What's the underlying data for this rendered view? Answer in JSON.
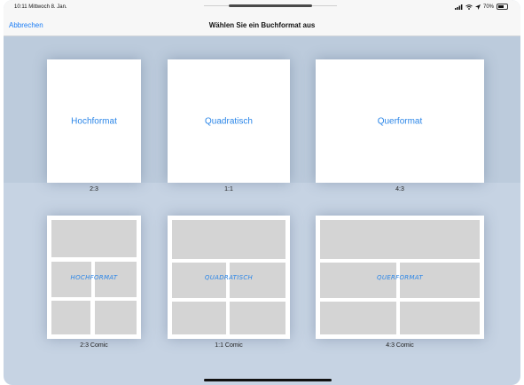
{
  "status": {
    "time_date": "10:11  Mittwoch 8. Jan.",
    "battery_text": "70%"
  },
  "nav": {
    "cancel_label": "Abbrechen",
    "title": "Wählen Sie ein Buchformat aus"
  },
  "formats": [
    {
      "label": "Hochformat",
      "ratio": "2:3"
    },
    {
      "label": "Quadratisch",
      "ratio": "1:1"
    },
    {
      "label": "Querformat",
      "ratio": "4:3"
    }
  ],
  "comics": [
    {
      "label": "HOCHFORMAT",
      "ratio": "2:3 Comic"
    },
    {
      "label": "QUADRATISCH",
      "ratio": "1:1 Comic"
    },
    {
      "label": "QUERFORMAT",
      "ratio": "4:3 Comic"
    }
  ],
  "colors": {
    "accent": "#1a7cf5",
    "background": "#c6d3e3",
    "panel": "#d4d4d4"
  }
}
